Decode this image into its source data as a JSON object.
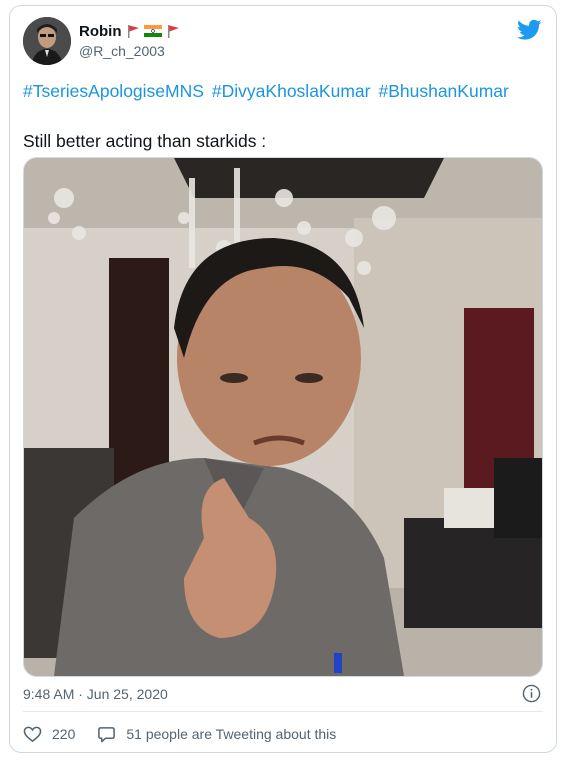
{
  "user": {
    "display_name": "Robin",
    "handle": "@R_ch_2003",
    "flags": [
      "red-flag-icon",
      "india-flag-icon",
      "red-flag-icon"
    ],
    "avatar": "avatar-photo"
  },
  "hashtags": [
    "#TseriesApologiseMNS",
    "#DivyaKhoslaKumar",
    "#BhushanKumar"
  ],
  "tweet_text": "Still better acting than starkids :",
  "media": {
    "description_icon": "video-thumbnail"
  },
  "timestamp": "9:48 AM · Jun 25, 2020",
  "actions": {
    "like_count": "220",
    "conversation_text": "51 people are Tweeting about this"
  },
  "colors": {
    "link": "#1b95e0",
    "brand": "#1d9bf0",
    "muted": "#536471",
    "border": "#cfd9de"
  }
}
